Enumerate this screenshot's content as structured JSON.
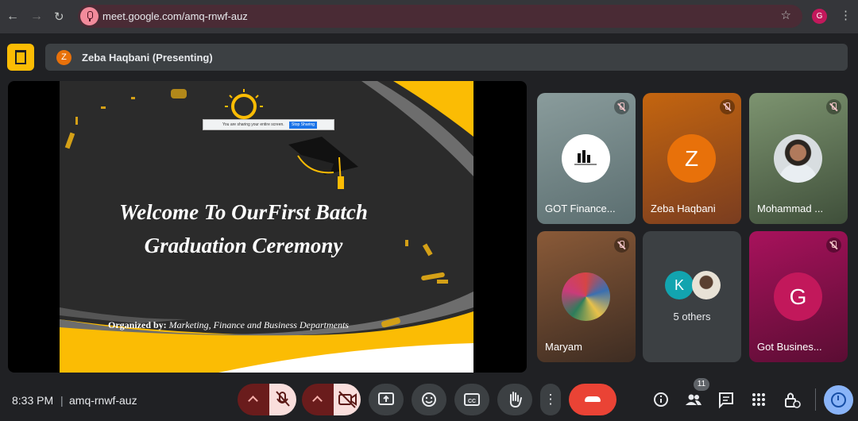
{
  "browser": {
    "back_icon": "back-arrow-icon",
    "forward_icon": "forward-arrow-icon",
    "reload_icon": "reload-icon",
    "url": "meet.google.com/amq-rnwf-auz",
    "profile_initial": "G"
  },
  "presenting": {
    "avatar_initial": "Z",
    "label": "Zeba Haqbani (Presenting)"
  },
  "slide": {
    "title_line1": "Welcome To OurFirst Batch",
    "title_line2": "Graduation Ceremony",
    "organized_label": "Organized by:",
    "organized_by": "Marketing, Finance and Business Departments",
    "share_bar_text": "You are sharing your entire screen.",
    "share_bar_button": "Stop Sharing",
    "colors": {
      "accent": "#fbbc04",
      "background": "#2b2b2b"
    }
  },
  "participants": [
    {
      "name": "GOT Finance...",
      "kind": "logo",
      "muted": true,
      "bg": "#7f8c8d"
    },
    {
      "name": "Zeba Haqbani",
      "kind": "initial",
      "initial": "Z",
      "muted": true,
      "bg": "#a0521a",
      "avatar_color": "#e8710a"
    },
    {
      "name": "Mohammad ...",
      "kind": "photo",
      "muted": true,
      "bg": "#5d7150"
    },
    {
      "name": "Maryam",
      "kind": "photo",
      "muted": true,
      "bg": "#6b4a33"
    },
    {
      "name": "5 others",
      "kind": "others",
      "initial": "K",
      "avatar_color": "#12a4af",
      "bg": "#3c4043"
    },
    {
      "name": "Got Busines...",
      "kind": "initial",
      "initial": "G",
      "muted": true,
      "bg": "#8f1450",
      "avatar_color": "#c2185b"
    }
  ],
  "bottom": {
    "time": "8:33 PM",
    "separator": "|",
    "meeting_code": "amq-rnwf-auz",
    "people_count": "11"
  }
}
